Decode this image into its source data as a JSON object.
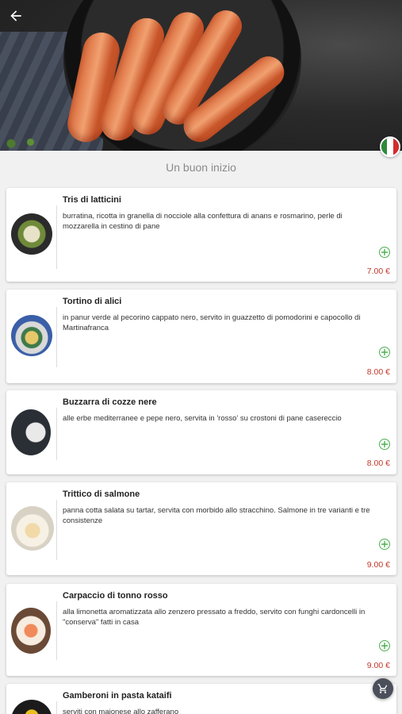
{
  "header": {
    "back_icon": "arrow-left-icon",
    "language_flag": "italy-flag-icon"
  },
  "section": {
    "title": "Un buon inizio"
  },
  "dishes": [
    {
      "name": "Tris di latticini",
      "description": "burratina, ricotta in granella di nocciole alla confettura di anans e rosmarino, perle di mozzarella in cestino di pane",
      "price": "7.00 €"
    },
    {
      "name": "Tortino di alici",
      "description": "in panur verde al pecorino cappato nero, servito in guazzetto di pomodorini e capocollo di Martinafranca",
      "price": "8.00 €"
    },
    {
      "name": "Buzzarra di cozze nere",
      "description": "alle erbe mediterranee e pepe nero, servita in 'rosso' su crostoni di pane casereccio",
      "price": "8.00 €"
    },
    {
      "name": "Trittico di salmone",
      "description": "panna cotta salata su tartar, servita con morbido allo stracchino. Salmone in tre varianti e tre consistenze",
      "price": "9.00 €"
    },
    {
      "name": "Carpaccio di tonno rosso",
      "description": "alla limonetta aromatizzata allo zenzero pressato a freddo, servito con funghi cardoncelli in \"conserva\" fatti in casa",
      "price": "9.00 €"
    },
    {
      "name": "Gamberoni in pasta kataifi",
      "description": "serviti con maionese allo zafferano",
      "price": ""
    }
  ],
  "colors": {
    "price": "#c0392b",
    "add": "#4caf50",
    "fab": "#4a4f5a"
  },
  "icons": {
    "add": "plus-circle-icon",
    "cart": "shopping-cart-icon"
  }
}
